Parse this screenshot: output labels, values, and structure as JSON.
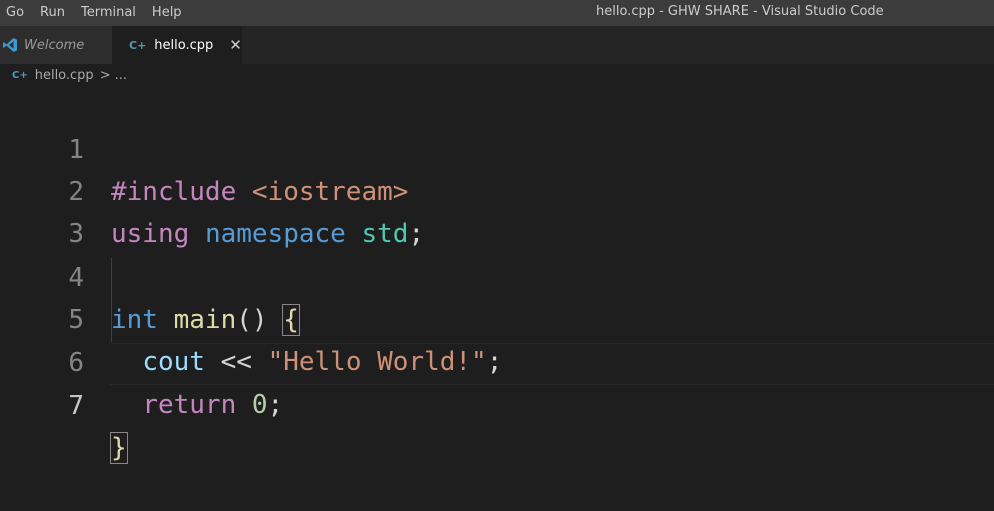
{
  "menu": {
    "items": [
      "Go",
      "Run",
      "Terminal",
      "Help"
    ]
  },
  "window_title": "hello.cpp - GHW SHARE - Visual Studio Code",
  "tabs": [
    {
      "label": "Welcome",
      "icon": "vscode-logo-icon"
    },
    {
      "label": "hello.cpp",
      "icon": "cpp-file-icon",
      "close": "✕"
    }
  ],
  "breadcrumb": {
    "file": "hello.cpp",
    "separator": ">",
    "more": "..."
  },
  "editor": {
    "line_numbers": [
      "1",
      "2",
      "3",
      "4",
      "5",
      "6",
      "7"
    ],
    "lines": [
      {
        "tokens": [
          "#include",
          " ",
          "<iostream>"
        ]
      },
      {
        "tokens": [
          "using",
          " ",
          "namespace",
          " ",
          "std",
          ";"
        ]
      },
      {
        "tokens": []
      },
      {
        "tokens": [
          "int",
          " ",
          "main",
          "()",
          " ",
          "{"
        ]
      },
      {
        "tokens": [
          "  ",
          "cout",
          " ",
          "<<",
          " ",
          "\"Hello World!\"",
          ";"
        ]
      },
      {
        "tokens": [
          "  ",
          "return",
          " ",
          "0",
          ";"
        ]
      },
      {
        "tokens": [
          "}"
        ]
      }
    ]
  },
  "colors": {
    "keyword": "#c586c0",
    "type": "#569cd6",
    "namespace": "#4ec9b0",
    "function": "#dcdcaa",
    "variable": "#9cdcfe",
    "string": "#ce9178",
    "number": "#b5cea8",
    "background": "#1e1e1e"
  }
}
